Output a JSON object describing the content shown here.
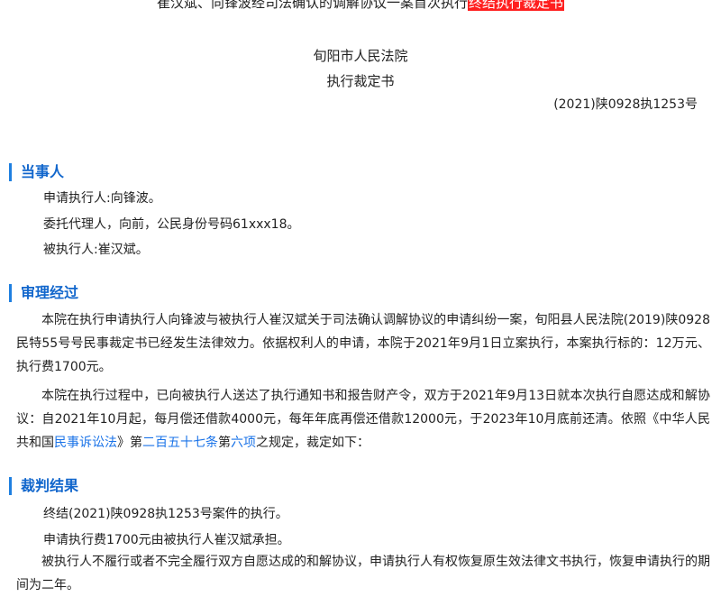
{
  "header": {
    "title_prefix": "崔汉斌、向锋波经司法确认的调解协议一案首次执行",
    "title_highlight": "终结执行裁定书",
    "court": "旬阳市人民法院",
    "doc_type": "执行裁定书",
    "case_number": "(2021)陕0928执1253号"
  },
  "sections": {
    "parties": {
      "heading": "当事人",
      "lines": [
        "申请执行人:向锋波。",
        "委托代理人，向前，公民身份号码61xxx18。",
        "被执行人:崔汉斌。"
      ]
    },
    "process": {
      "heading": "审理经过",
      "p1": "本院在执行申请执行人向锋波与被执行人崔汉斌关于司法确认调解协议的申请纠纷一案，旬阳县人民法院(2019)陕0928民特55号号民事裁定书已经发生法律效力。依据权利人的申请，本院于2021年9月1日立案执行，本案执行标的：12万元、执行费1700元。",
      "p2_a": "本院在执行过程中，已向被执行人送达了执行通知书和报告财产令，双方于2021年9月13日就本次执行自愿达成和解协议：自2021年10月起，每月偿还借款4000元，每年年底再偿还借款12000元，于2023年10月底前还清。依照《中华人民共和国",
      "p2_link1": "民事诉讼法",
      "p2_b": "》第",
      "p2_link2": "二百五十七条",
      "p2_c": "第",
      "p2_link3": "六项",
      "p2_d": "之规定，裁定如下："
    },
    "result": {
      "heading": "裁判结果",
      "lines": [
        "终结(2021)陕0928执1253号案件的执行。",
        "申请执行费1700元由被执行人崔汉斌承担。"
      ],
      "p3": "被执行人不履行或者不完全履行双方自愿达成的和解协议，申请执行人有权恢复原生效法律文书执行，恢复申请执行的期间为二年。"
    }
  },
  "colors": {
    "accent": "#1e7fe0",
    "highlight": "#ff1f1f",
    "link": "#1a73e8"
  }
}
